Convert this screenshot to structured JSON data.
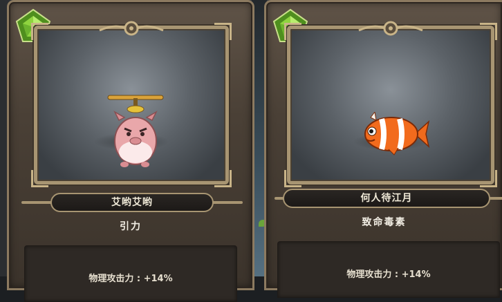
{
  "colors": {
    "card_bg": "#4a4036",
    "frame_gold": "#a89572",
    "gem_green": "#7cc63a",
    "text": "#f0ead8"
  },
  "cards": [
    {
      "rarity_icon": "green-pentagon-gem-icon",
      "pet": "helicopter-pig-icon",
      "name": "艾哟艾哟",
      "skill": "引力",
      "stat": "物理攻击力 : +14%"
    },
    {
      "rarity_icon": "green-pentagon-gem-icon",
      "pet": "clownfish-icon",
      "name": "何人待江月",
      "skill": "致命毒素",
      "stat": "物理攻击力 : +14%"
    }
  ]
}
